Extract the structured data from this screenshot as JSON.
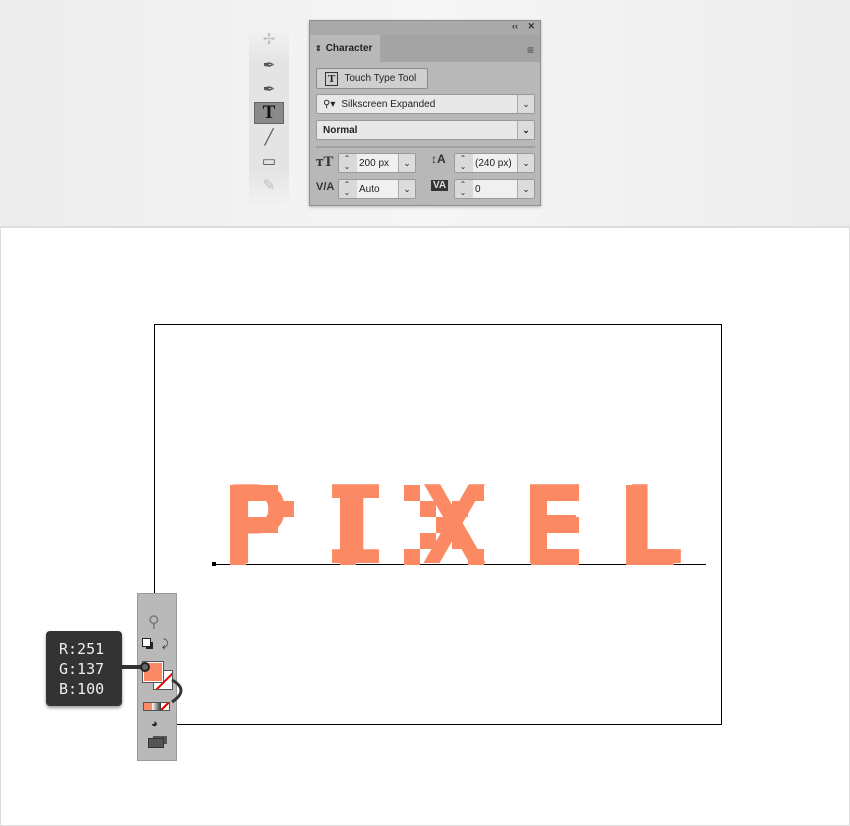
{
  "toolbar": {
    "tools": [
      {
        "name": "puppet-warp-icon",
        "glyph": "✢"
      },
      {
        "name": "pen-icon",
        "glyph": "✒"
      },
      {
        "name": "curvature-icon",
        "glyph": "✒"
      },
      {
        "name": "type-icon",
        "glyph": "T",
        "selected": true
      },
      {
        "name": "line-icon",
        "glyph": "╱"
      },
      {
        "name": "rectangle-icon",
        "glyph": "▭"
      },
      {
        "name": "paintbrush-icon",
        "glyph": "✎"
      }
    ]
  },
  "character_panel": {
    "collapse_glyph": "‹‹",
    "close_glyph": "✕",
    "tab_label": "Character",
    "touch_type_label": "Touch Type Tool",
    "font_family": "Silkscreen Expanded",
    "font_style": "Normal",
    "font_size": "200 px",
    "leading": "(240 px)",
    "kerning": "Auto",
    "tracking": "0"
  },
  "artwork": {
    "text": "PIXEL",
    "fill_color": "#FB8964"
  },
  "color_tooltip": {
    "r": "R:251",
    "g": "G:137",
    "b": "B:100"
  },
  "colors": {
    "fill": "#FB8964",
    "stroke": "none"
  }
}
